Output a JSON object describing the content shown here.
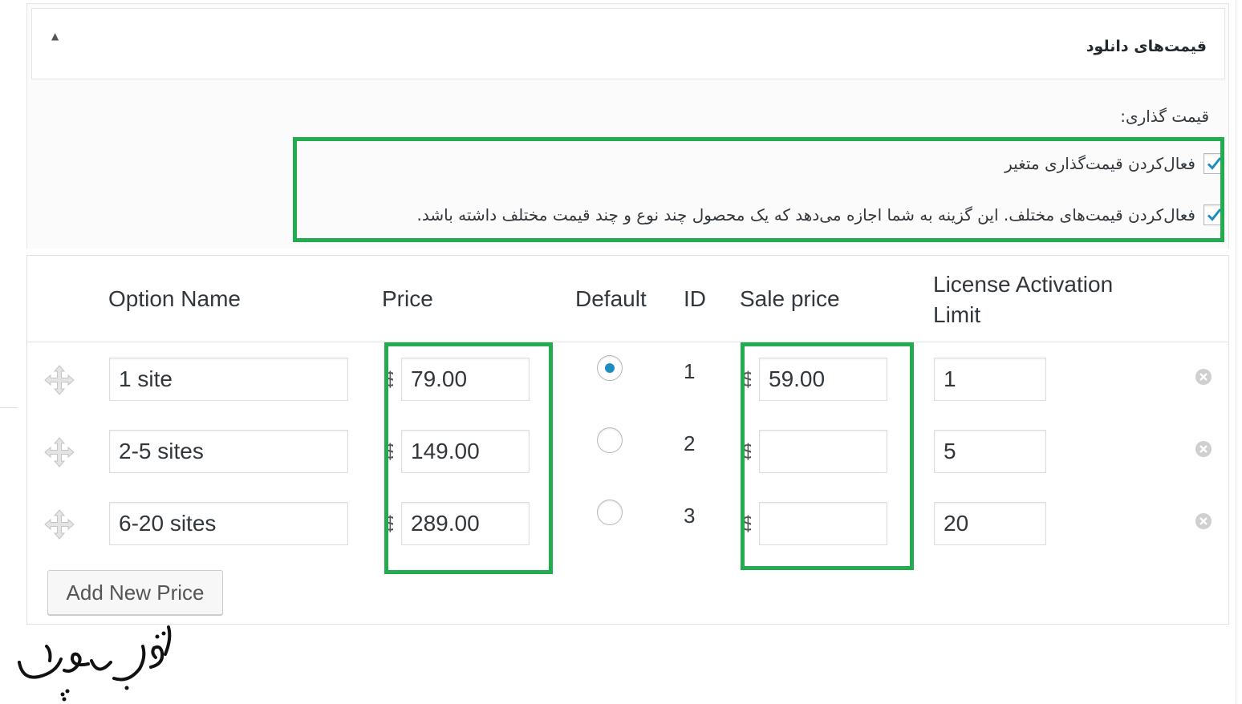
{
  "metabox": {
    "title": "قیمت‌های دانلود",
    "toggle_glyph": "▲",
    "pricing_label": "قیمت گذاری:",
    "options": [
      {
        "label": "فعال‌کردن قیمت‌گذاری متغیر",
        "checked": true
      },
      {
        "label": "فعال‌کردن قیمت‌های مختلف. این گزینه به شما اجازه می‌دهد که یک محصول چند نوع و چند قیمت مختلف داشته باشد.",
        "checked": true
      }
    ]
  },
  "table": {
    "headers": {
      "option_name": "Option Name",
      "price": "Price",
      "default": "Default",
      "id": "ID",
      "sale_price": "Sale price",
      "license_line1": "License Activation",
      "license_line2": "Limit"
    },
    "currency_symbol": "$",
    "rows": [
      {
        "option_name": "1 site",
        "price": "79.00",
        "default": true,
        "id": "1",
        "sale_price": "59.00",
        "license_limit": "1"
      },
      {
        "option_name": "2-5 sites",
        "price": "149.00",
        "default": false,
        "id": "2",
        "sale_price": "",
        "license_limit": "5"
      },
      {
        "option_name": "6-20 sites",
        "price": "289.00",
        "default": false,
        "id": "3",
        "sale_price": "",
        "license_limit": "20"
      }
    ],
    "add_button": "Add New Price"
  },
  "logo_text": "نوین وردپرس",
  "colors": {
    "highlight": "#22ac4f",
    "checkmark": "#1e8cbe",
    "radio_selected": "#1e8cbe"
  }
}
